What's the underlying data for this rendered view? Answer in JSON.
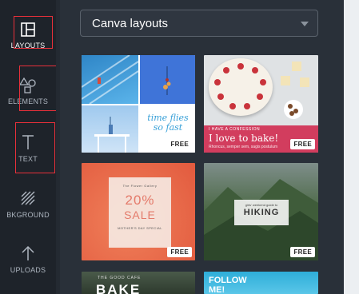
{
  "sidebar": {
    "items": [
      {
        "label": "LAYOUTS",
        "icon": "layouts-icon"
      },
      {
        "label": "ELEMENTS",
        "icon": "elements-icon"
      },
      {
        "label": "TEXT",
        "icon": "text-icon"
      },
      {
        "label": "BKGROUND",
        "icon": "background-icon"
      },
      {
        "label": "UPLOADS",
        "icon": "uploads-icon"
      }
    ]
  },
  "panel": {
    "dropdown": {
      "value": "Canva layouts"
    },
    "layouts": [
      {
        "badge": "FREE",
        "text": [
          "time flies",
          "so fast"
        ]
      },
      {
        "badge": "FREE",
        "kicker": "I HAVE A CONFESSION",
        "title": "I love to bake!",
        "sub": "Rhoncus, semper sem, sagis postulum"
      },
      {
        "badge": "FREE",
        "kicker": "The Flower Gallery",
        "big1": "20%",
        "big2": "SALE",
        "sub": "MOTHER'S DAY SPECIAL"
      },
      {
        "badge": "FREE",
        "kicker": "girls' weekend guide to",
        "title": "HIKING"
      },
      {
        "kicker": "THE GOOD CAFE",
        "title": "BAKE"
      },
      {
        "title": "FOLLOW ME!"
      }
    ]
  },
  "colors": {
    "accent": "#d23d5e",
    "highlight": "#e8303a",
    "rail": "#1e232a",
    "panel": "#293039"
  }
}
